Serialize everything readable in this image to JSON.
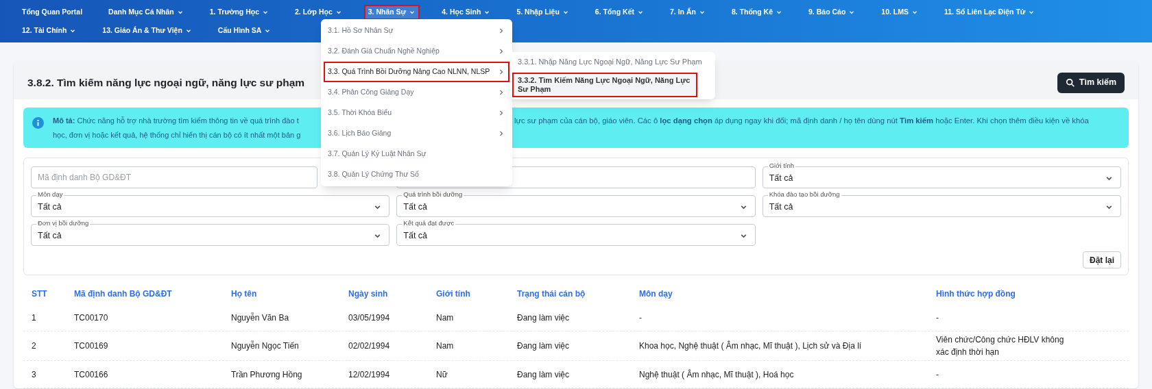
{
  "nav": [
    {
      "label": "Tổng Quan Portal",
      "dropdown": false,
      "selected": false
    },
    {
      "label": "Danh Mục Cá Nhân",
      "dropdown": true,
      "selected": false
    },
    {
      "label": "1. Trường Học",
      "dropdown": true,
      "selected": false
    },
    {
      "label": "2. Lớp Học",
      "dropdown": true,
      "selected": false
    },
    {
      "label": "3. Nhân Sự",
      "dropdown": true,
      "selected": true
    },
    {
      "label": "4. Học Sinh",
      "dropdown": true,
      "selected": false
    },
    {
      "label": "5. Nhập Liệu",
      "dropdown": true,
      "selected": false
    },
    {
      "label": "6. Tổng Kết",
      "dropdown": true,
      "selected": false
    },
    {
      "label": "7. In Ấn",
      "dropdown": true,
      "selected": false
    },
    {
      "label": "8. Thống Kê",
      "dropdown": true,
      "selected": false
    },
    {
      "label": "9. Báo Cáo",
      "dropdown": true,
      "selected": false
    },
    {
      "label": "10. LMS",
      "dropdown": true,
      "selected": false
    },
    {
      "label": "11. Sổ Liên Lạc Điện Tử",
      "dropdown": true,
      "selected": false
    },
    {
      "label": "12. Tài Chính",
      "dropdown": true,
      "selected": false
    },
    {
      "label": "13. Giáo Án & Thư Viện",
      "dropdown": true,
      "selected": false
    },
    {
      "label": "Cấu Hình SA",
      "dropdown": true,
      "selected": false
    }
  ],
  "menu": [
    {
      "label": "3.1. Hồ Sơ Nhân Sự",
      "has_children": true,
      "selected": false
    },
    {
      "label": "3.2. Đánh Giá Chuẩn Nghề Nghiệp",
      "has_children": true,
      "selected": false
    },
    {
      "label": "3.3. Quá Trình Bồi Dưỡng Nâng Cao NLNN, NLSP",
      "has_children": true,
      "selected": true
    },
    {
      "label": "3.4. Phân Công Giảng Dạy",
      "has_children": true,
      "selected": false
    },
    {
      "label": "3.5. Thời Khóa Biểu",
      "has_children": true,
      "selected": false
    },
    {
      "label": "3.6. Lịch Báo Giảng",
      "has_children": true,
      "selected": false
    },
    {
      "label": "3.7. Quản Lý Kỷ Luật Nhân Sự",
      "has_children": false,
      "selected": false
    },
    {
      "label": "3.8. Quản Lý Chứng Thư Số",
      "has_children": false,
      "selected": false
    }
  ],
  "submenu": [
    {
      "label": "3.3.1. Nhập Năng Lực Ngoại Ngữ, Năng Lực Sư Phạm",
      "selected": false
    },
    {
      "label": "3.3.2. Tìm Kiếm Năng Lực Ngoại Ngữ, Năng Lực Sư Phạm",
      "selected": true
    }
  ],
  "page_title": "3.8.2. Tìm kiếm năng lực ngoại ngữ, năng lực sư phạm",
  "search_button": "Tìm kiếm",
  "description": {
    "left_lines": [
      "**Mô tả:** Chức năng hỗ trợ nhà trường tìm kiếm thông tin về quá trình đào t",
      "học, đơn vị hoặc kết quả, hệ thống chỉ hiển thị cán bộ có ít nhất một bản g"
    ],
    "right_line": "lực sư phạm của cán bộ, giáo viên. Các ô **lọc dạng chọn** áp dụng ngay khi đổi; mã định danh / họ tên dùng nút **Tìm kiếm** hoặc Enter. Khi chọn thêm điều kiện về khóa"
  },
  "filters": [
    {
      "kind": "text",
      "placeholder": "Mã định danh Bộ GD&ĐT"
    },
    {
      "kind": "text"
    },
    {
      "kind": "select",
      "label": "Giới tính",
      "value": "Tất cả"
    },
    {
      "kind": "select",
      "label": "Môn dạy",
      "value": "Tất cả"
    },
    {
      "kind": "select",
      "label": "Quá trình bồi dưỡng",
      "value": "Tất cả"
    },
    {
      "kind": "select",
      "label": "Khóa đào tạo bồi dưỡng",
      "value": "Tất cả"
    },
    {
      "kind": "select",
      "label": "Đơn vị bồi dưỡng",
      "value": "Tất cả"
    },
    {
      "kind": "select",
      "label": "Kết quả đạt được",
      "value": "Tất cả"
    }
  ],
  "reset_button": "Đặt lại",
  "table": {
    "columns": [
      "STT",
      "Mã định danh Bộ GD&ĐT",
      "Họ tên",
      "Ngày sinh",
      "Giới tính",
      "Trạng thái cán bộ",
      "Môn dạy",
      "Hình thức hợp đồng"
    ],
    "rows": [
      [
        "1",
        "TC00170",
        "Nguyễn Văn Ba",
        "03/05/1994",
        "Nam",
        "Đang làm việc",
        "-",
        "-"
      ],
      [
        "2",
        "TC00169",
        "Nguyễn Ngọc Tiến",
        "02/02/1994",
        "Nam",
        "Đang làm việc",
        "Khoa học, Nghệ thuật ( Âm nhạc, Mĩ thuật ), Lịch sử và Địa lí",
        "Viên chức/Công chức HĐLV không xác định thời hạn"
      ],
      [
        "3",
        "TC00166",
        "Trần Phương Hồng",
        "12/02/1994",
        "Nữ",
        "Đang làm việc",
        "Nghệ thuật ( Âm nhạc, Mĩ thuật ), Hoá học",
        "-"
      ]
    ]
  }
}
